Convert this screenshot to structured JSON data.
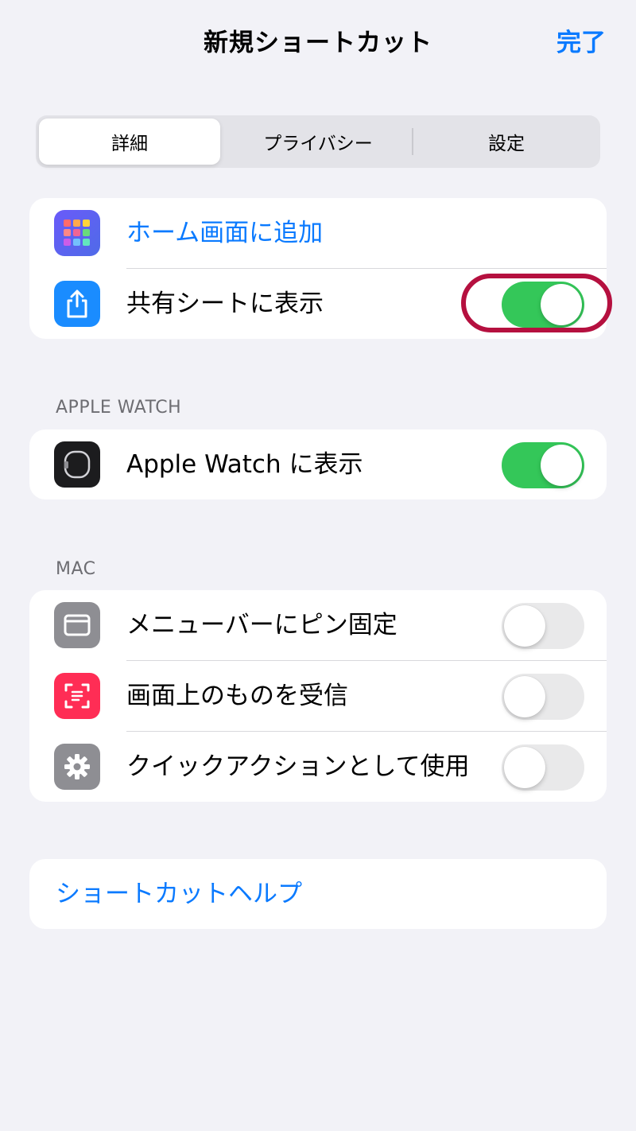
{
  "header": {
    "title": "新規ショートカット",
    "done_label": "完了"
  },
  "segments": {
    "items": [
      "詳細",
      "プライバシー",
      "設定"
    ],
    "selected": "詳細"
  },
  "group_main": {
    "items": [
      {
        "label": "ホーム画面に追加",
        "icon": "home-screen-grid-icon",
        "icon_color": "#5a55e0",
        "style": "link"
      },
      {
        "label": "共有シートに表示",
        "icon": "share-icon",
        "icon_color": "#1a8cff",
        "toggle": true
      }
    ]
  },
  "apple_watch": {
    "header": "APPLE WATCH",
    "items": [
      {
        "label": "Apple Watch に表示",
        "icon": "apple-watch-icon",
        "icon_color": "#1c1c1e",
        "toggle": true
      }
    ]
  },
  "mac": {
    "header": "MAC",
    "items": [
      {
        "label": "メニューバーにピン固定",
        "icon": "menu-bar-window-icon",
        "icon_color": "#8e8e93",
        "toggle": false
      },
      {
        "label": "画面上のものを受信",
        "icon": "screen-scan-icon",
        "icon_color": "#ff2d55",
        "toggle": false
      },
      {
        "label": "クイックアクションとして使用",
        "icon": "gear-icon",
        "icon_color": "#8e8e93",
        "toggle": false
      }
    ]
  },
  "help": {
    "label": "ショートカットヘルプ"
  },
  "colors": {
    "accent": "#0a7aff",
    "toggle_on": "#34c759",
    "highlight": "#b5103f"
  }
}
